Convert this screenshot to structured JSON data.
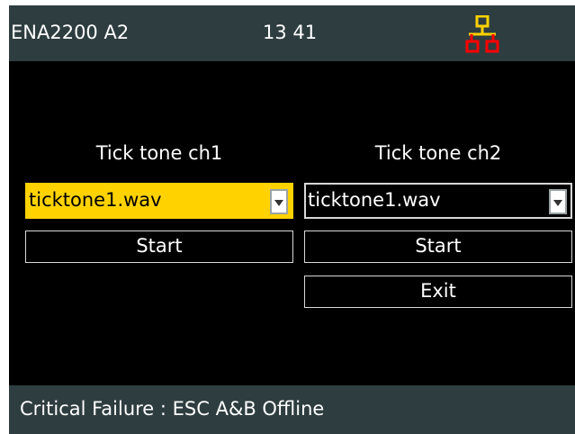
{
  "header": {
    "title": "ENA2200 A2",
    "time": "13 41",
    "network_icon": "network-icon",
    "network_icon_colors": {
      "top": "#ffd200",
      "bottom": "#ff0000"
    }
  },
  "channels": [
    {
      "label": "Tick tone ch1",
      "selected_file": "ticktone1.wav",
      "start_label": "Start",
      "highlighted": true
    },
    {
      "label": "Tick tone ch2",
      "selected_file": "ticktone1.wav",
      "start_label": "Start",
      "highlighted": false
    }
  ],
  "exit_label": "Exit",
  "footer": {
    "status": "Critical Failure : ESC A&B Offline"
  },
  "colors": {
    "bar_background": "#2e3d40",
    "screen_background": "#000000",
    "highlight": "#ffd200",
    "alert": "#ff0000"
  }
}
